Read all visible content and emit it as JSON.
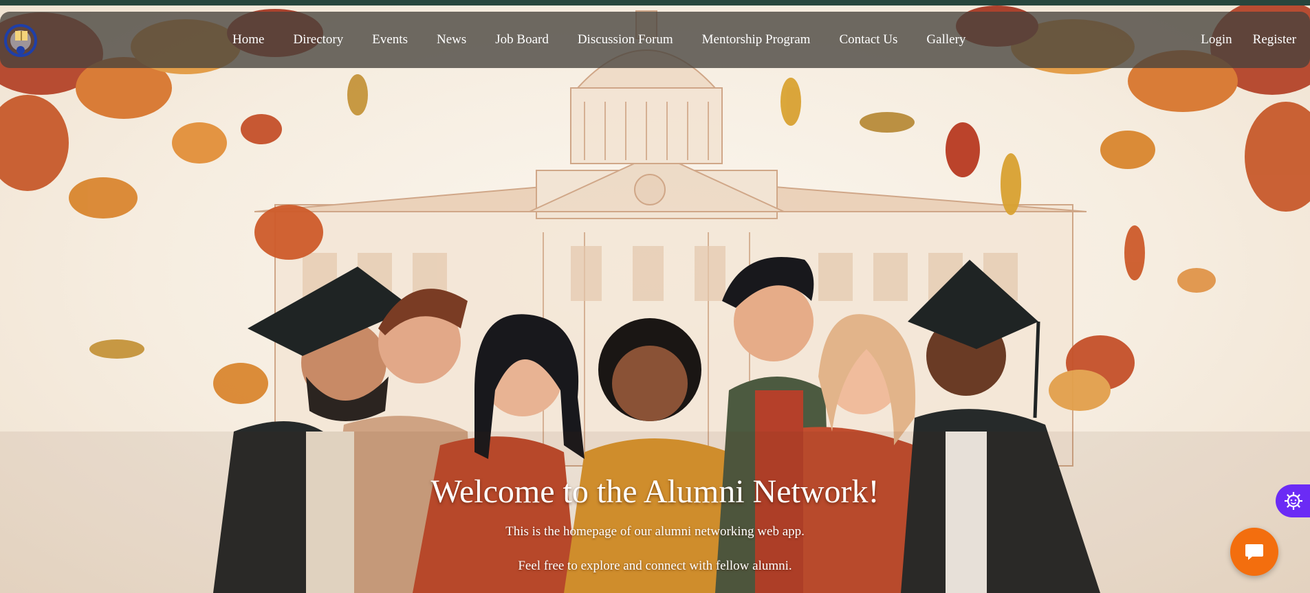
{
  "nav": {
    "links": [
      "Home",
      "Directory",
      "Events",
      "News",
      "Job Board",
      "Discussion Forum",
      "Mentorship Program",
      "Contact Us",
      "Gallery"
    ],
    "login": "Login",
    "register": "Register"
  },
  "hero": {
    "title": "Welcome to the Alumni Network!",
    "line1": "This is the homepage of our alumni networking web app.",
    "line2": "Feel free to explore and connect with fellow alumni."
  },
  "icons": {
    "logo": "book-globe-logo",
    "settings": "gear-icon",
    "chat": "chat-bubble-icon"
  },
  "colors": {
    "navbar": "#46423c",
    "chat_button": "#f36e0e",
    "settings_button": "#6b2bf5",
    "top_strip": "#27463d"
  }
}
